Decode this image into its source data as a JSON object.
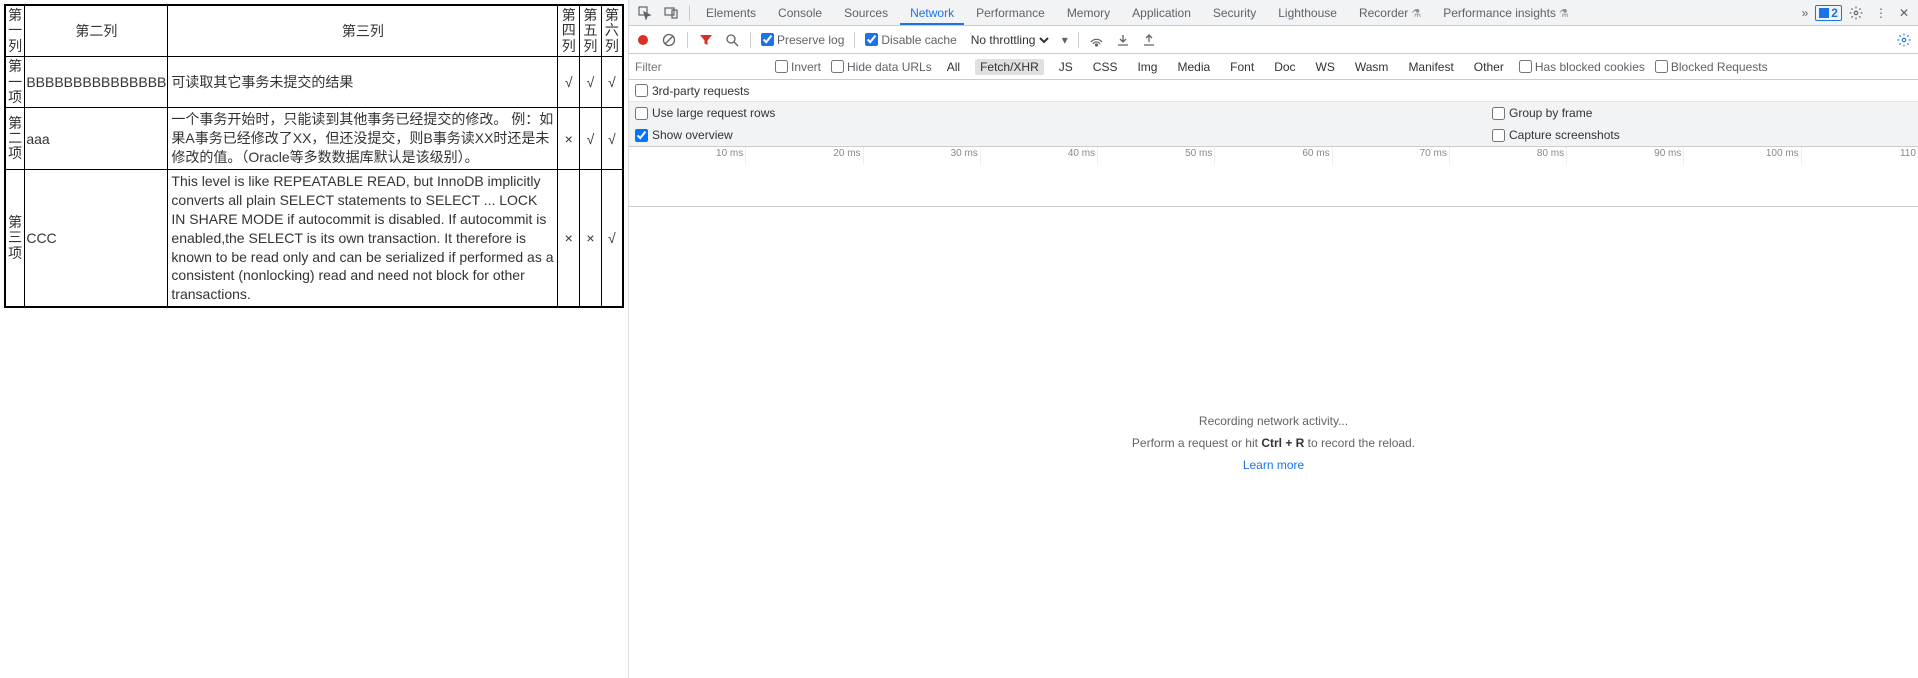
{
  "table": {
    "headers": [
      "第一列",
      "第二列",
      "第三列",
      "第四列",
      "第五列",
      "第六列"
    ],
    "rows": [
      {
        "label": "第一项",
        "c2": "BBBBBBBBBBBBBBB",
        "c3": "可读取其它事务未提交的结果",
        "c4": "√",
        "c5": "√",
        "c6": "√"
      },
      {
        "label": "第二项",
        "c2": "aaa",
        "c3": "一个事务开始时，只能读到其他事务已经提交的修改。 例：如果A事务已经修改了XX，但还没提交，则B事务读XX时还是未修改的值。（Oracle等多数数据库默认是该级别）。",
        "c4": "×",
        "c5": "√",
        "c6": "√"
      },
      {
        "label": "第三项",
        "c2": "CCC",
        "c3": "This level is like REPEATABLE READ, but InnoDB implicitly converts all plain SELECT statements to SELECT ... LOCK IN SHARE MODE if autocommit is disabled. If autocommit is enabled,the SELECT is its own transaction. It therefore is known to be read only and can be serialized if performed as a consistent (nonlocking) read and need not block for other transactions.",
        "c4": "×",
        "c5": "×",
        "c6": "√"
      }
    ]
  },
  "devtools": {
    "tabs": [
      "Elements",
      "Console",
      "Sources",
      "Network",
      "Performance",
      "Memory",
      "Application",
      "Security",
      "Lighthouse",
      "Recorder",
      "Performance insights"
    ],
    "active_tab": "Network",
    "badge_count": "2",
    "toolbar": {
      "preserve_log": "Preserve log",
      "disable_cache": "Disable cache",
      "throttling": "No throttling"
    },
    "filterbar": {
      "placeholder": "Filter",
      "invert": "Invert",
      "hide_data_urls": "Hide data URLs",
      "types": [
        "All",
        "Fetch/XHR",
        "JS",
        "CSS",
        "Img",
        "Media",
        "Font",
        "Doc",
        "WS",
        "Wasm",
        "Manifest",
        "Other"
      ],
      "selected_type": "Fetch/XHR",
      "has_blocked_cookies": "Has blocked cookies",
      "blocked_requests": "Blocked Requests"
    },
    "subbar": {
      "third_party": "3rd-party requests"
    },
    "options": {
      "use_large": "Use large request rows",
      "group_by_frame": "Group by frame",
      "show_overview": "Show overview",
      "capture_screenshots": "Capture screenshots"
    },
    "timeline_ticks": [
      "10 ms",
      "20 ms",
      "30 ms",
      "40 ms",
      "50 ms",
      "60 ms",
      "70 ms",
      "80 ms",
      "90 ms",
      "100 ms",
      "110"
    ],
    "empty": {
      "title": "Recording network activity...",
      "hint_prefix": "Perform a request or hit ",
      "hint_key": "Ctrl + R",
      "hint_suffix": " to record the reload.",
      "learn_more": "Learn more"
    }
  }
}
